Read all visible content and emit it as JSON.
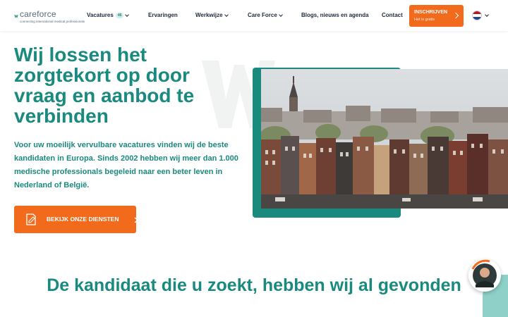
{
  "brand": {
    "name": "careforce",
    "tagline": "connecting international medical professionals"
  },
  "nav": {
    "items": [
      {
        "label": "Vacatures",
        "badge": "46",
        "dropdown": true
      },
      {
        "label": "Ervaringen",
        "dropdown": false
      },
      {
        "label": "Werkwijze",
        "dropdown": true
      },
      {
        "label": "Care Force",
        "dropdown": true
      },
      {
        "label": "Blogs, nieuws en agenda",
        "dropdown": false
      },
      {
        "label": "Contact",
        "dropdown": false
      }
    ],
    "register": {
      "label": "INSCHRIJVEN",
      "sublabel": "Het is gratis"
    },
    "language": "nl-flag-icon"
  },
  "hero": {
    "title": "Wij lossen het zorgtekort op door vraag en aanbod te verbinden",
    "text": "Voor uw moeilijk vervulbare vacatures vinden wij de beste kandidaten in Europa. Sinds 2002 hebben wij meer dan 1.000 medische professionals begeleid naar een beter leven in Nederland of België.",
    "button_label": "BEKIJK ONZE DIENSTEN"
  },
  "section": {
    "title": "De kandidaat die u zoekt, hebben wij al gevonden"
  },
  "colors": {
    "primary": "#1a8a7f",
    "accent": "#f26a1b",
    "nav_text": "#1e2a3a"
  }
}
